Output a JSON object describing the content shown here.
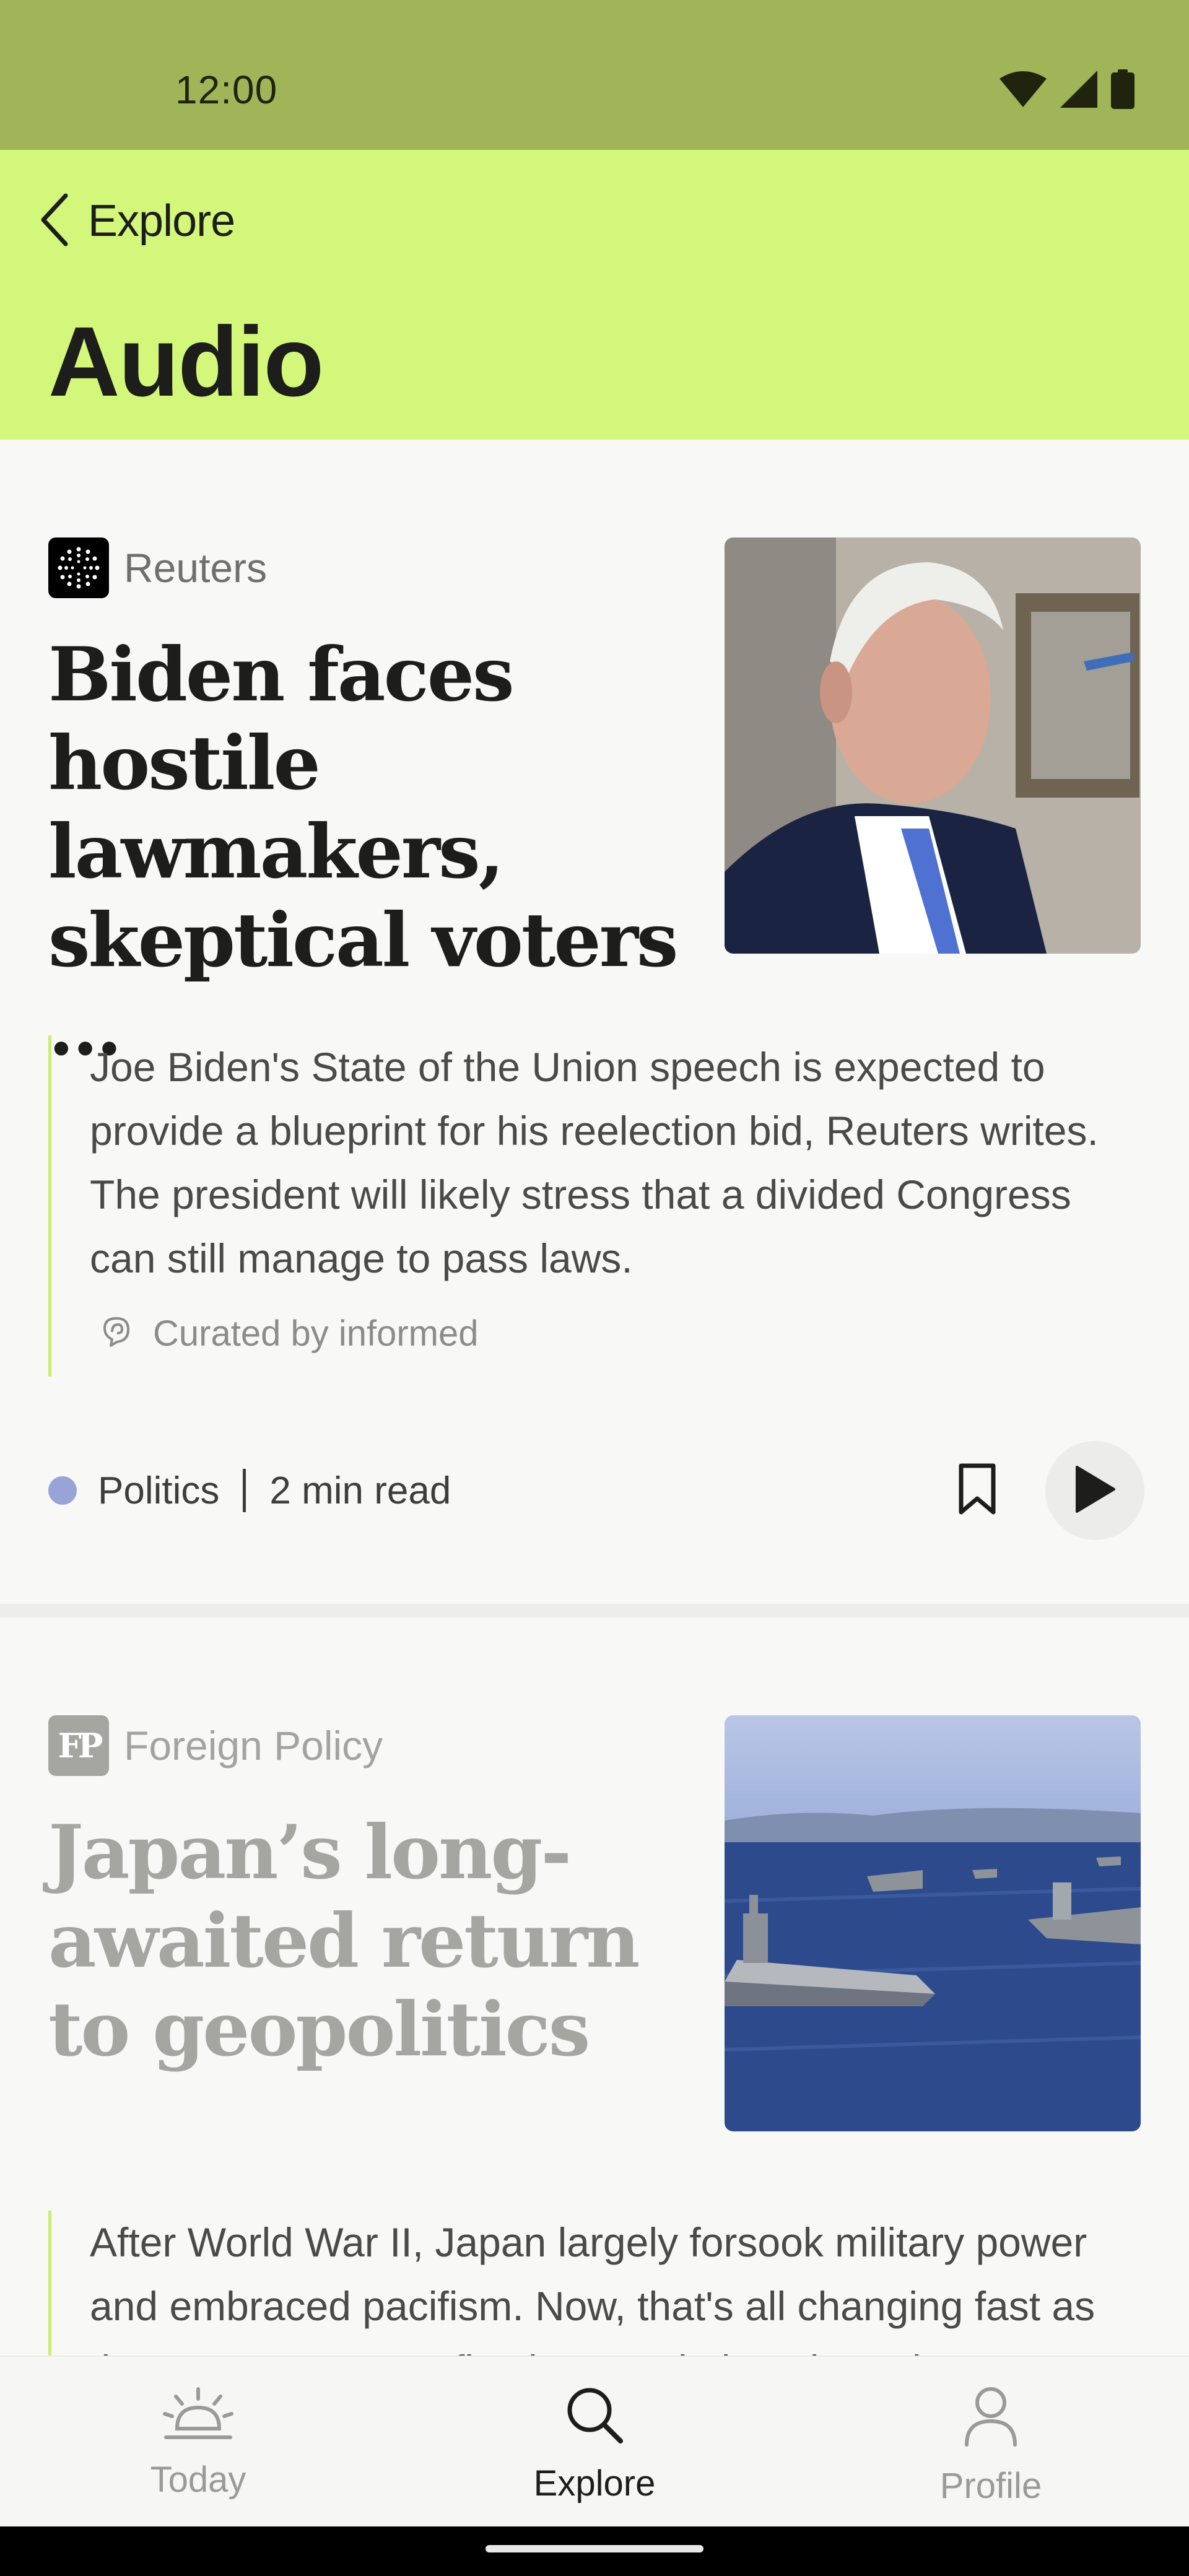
{
  "status_bar": {
    "time": "12:00",
    "icons": [
      "wifi-icon",
      "cellular-signal-icon",
      "battery-icon"
    ]
  },
  "header": {
    "back_label": "Explore",
    "title": "Audio",
    "background_color": "#d3f77a"
  },
  "articles": [
    {
      "source": "Reuters",
      "headline": "Biden faces hostile lawmakers, skeptical voters ...",
      "summary": "Joe Biden's State of the Union speech is expected to provide a blueprint for his reelection bid, Reuters writes. The president will likely stress that a divided Congress can still manage to pass laws.",
      "curated_label": "Curated by informed",
      "topic": "Politics",
      "topic_color": "#98a3d6",
      "read_time": "2 min read"
    },
    {
      "source": "Foreign Policy",
      "source_logo_text": "FP",
      "headline": "Japan’s long-awaited return to geopolitics",
      "summary": "After World War II, Japan largely forsook military power and embraced pacifism. Now, that's all changing fast as the country vows to flex its muscle in Asia and"
    }
  ],
  "bottom_nav": {
    "items": [
      {
        "label": "Today",
        "icon": "sunrise-icon",
        "active": false
      },
      {
        "label": "Explore",
        "icon": "search-icon",
        "active": true
      },
      {
        "label": "Profile",
        "icon": "profile-icon",
        "active": false
      }
    ]
  }
}
